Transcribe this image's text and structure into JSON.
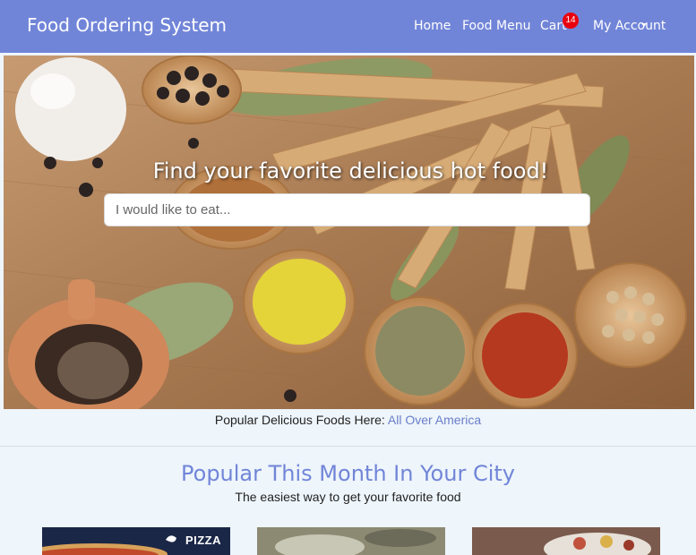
{
  "navbar": {
    "brand": "Food Ordering System",
    "links": {
      "home": "Home",
      "food_menu": "Food Menu",
      "cart": "Cart",
      "account": "My Account"
    },
    "cart_count": "14"
  },
  "hero": {
    "title": "Find your favorite delicious hot food!",
    "search_placeholder": "I would like to eat..."
  },
  "tagline": {
    "text": "Popular Delicious Foods Here: ",
    "link": "All Over America"
  },
  "section": {
    "title": "Popular This Month In Your City",
    "subtitle": "The easiest way to get your favorite food"
  },
  "cards": [
    {
      "label": "PIZZA"
    },
    {
      "label": ""
    },
    {
      "label": ""
    }
  ],
  "colors": {
    "navbar": "#7185d8",
    "badge": "#e8000f",
    "accent": "#7185d8",
    "background": "#eef5fb"
  }
}
